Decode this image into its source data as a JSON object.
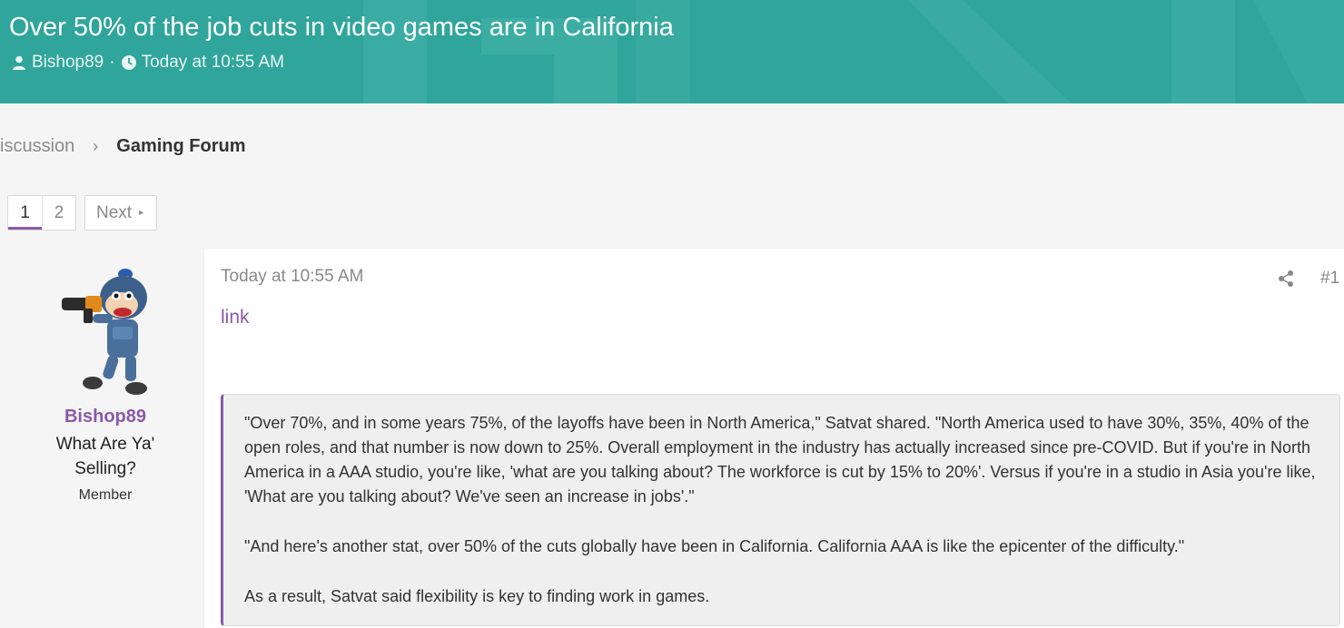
{
  "thread": {
    "title": "Over 50% of the job cuts in video games are in California",
    "author": "Bishop89",
    "separator": "·",
    "timestamp": "Today at 10:55 AM"
  },
  "breadcrumb": {
    "previous": "iscussion",
    "separator": "›",
    "current": "Gaming Forum"
  },
  "pagination": {
    "pages": [
      "1",
      "2"
    ],
    "current_page": "1",
    "next_label": "Next",
    "next_arrow": "▸"
  },
  "user": {
    "name": "Bishop89",
    "custom_title": "What Are Ya' Selling?",
    "role": "Member"
  },
  "post": {
    "date": "Today at 10:55 AM",
    "number": "#1",
    "link_text": "link",
    "quote_paragraphs": [
      "\"Over 70%, and in some years 75%, of the layoffs have been in North America,\" Satvat shared. \"North America used to have 30%, 35%, 40% of the open roles, and that number is now down to 25%. Overall employment in the industry has actually increased since pre-COVID. But if you're in North America in a AAA studio, you're like, 'what are you talking about? The workforce is cut by 15% to 20%'. Versus if you're in a studio in Asia you're like, 'What are you talking about? We've seen an increase in jobs'.\"",
      "\"And here's another stat, over 50% of the cuts globally have been in California. California AAA is like the epicenter of the difficulty.\"",
      "As a result, Satvat said flexibility is key to finding work in games."
    ]
  },
  "icons": {
    "author": "user-icon",
    "time": "clock-icon",
    "share": "share-icon"
  },
  "colors": {
    "banner": "#2fa59b",
    "accent": "#8a5aa6",
    "quote_bg": "#efefef"
  }
}
